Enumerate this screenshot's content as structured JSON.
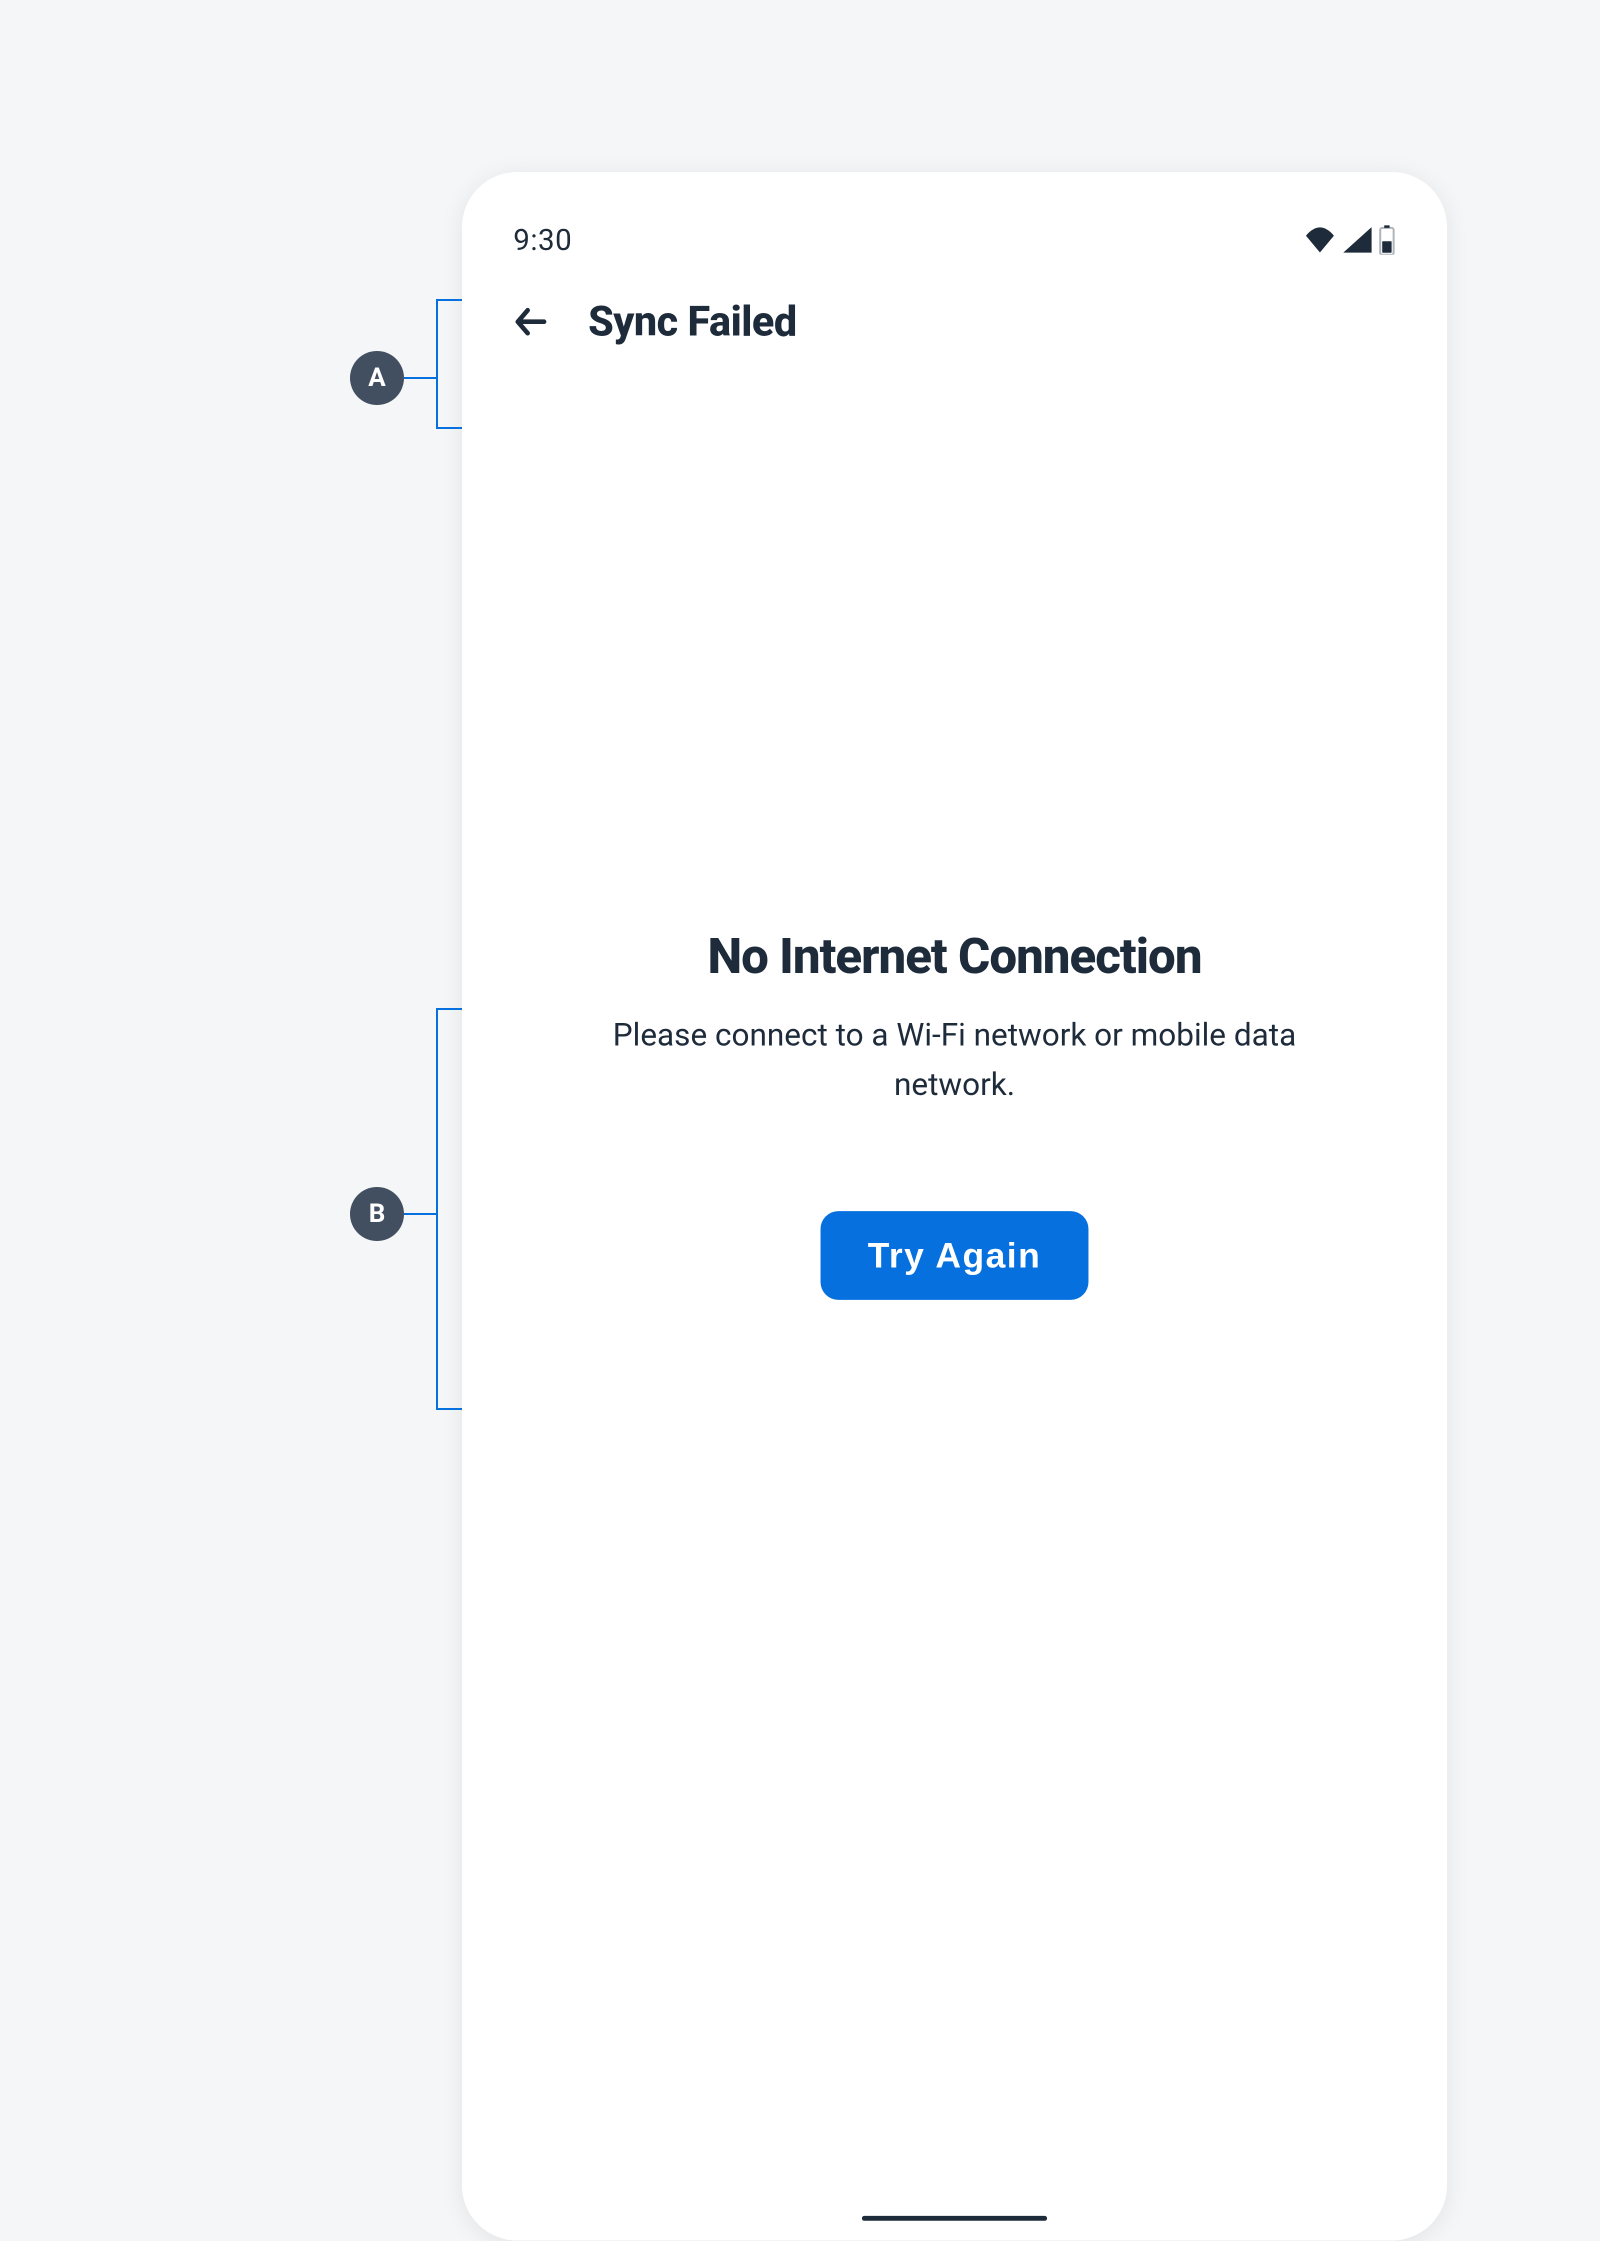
{
  "status_bar": {
    "time": "9:30"
  },
  "app_bar": {
    "title": "Sync Failed"
  },
  "error": {
    "title": "No Internet Connection",
    "message": "Please connect to a Wi-Fi network or mobile data network.",
    "button_label": "Try Again"
  },
  "annotations": {
    "a": "A",
    "b": "B"
  }
}
